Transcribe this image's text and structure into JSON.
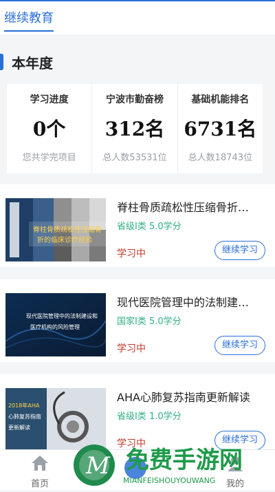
{
  "header": {
    "tab_label": "继续教育"
  },
  "section": {
    "title": "本年度"
  },
  "stats": [
    {
      "label": "学习进度",
      "value": "0个",
      "sub": "您共学完项目"
    },
    {
      "label": "宁波市勤奋榜",
      "value": "312名",
      "sub": "总人数53531位"
    },
    {
      "label": "基础机能排名",
      "value": "6731名",
      "sub": "总人数18743位"
    }
  ],
  "courses": [
    {
      "title": "脊柱骨质疏松性压缩骨折…",
      "level": "省级I类  5.0学分",
      "status": "学习中",
      "button": "继续学习",
      "thumb_text_1": "脊柱骨质疏松性压缩骨",
      "thumb_text_2": "折的临床诊疗经验"
    },
    {
      "title": "现代医院管理中的法制建…",
      "level": "国家I类  5.0学分",
      "status": "学习中",
      "button": "继续学习",
      "thumb_text_1": "现代医院管理中的法制建设和",
      "thumb_text_2": "医疗机构的风险管理"
    },
    {
      "title": "AHA心肺复苏指南更新解读",
      "level": "省级I类  1.0学分",
      "status": "学习中",
      "button": "继续学习",
      "thumb_text_1": "2018年AHA",
      "thumb_text_2": "心肺复苏指南",
      "thumb_text_3": "更新解读"
    }
  ],
  "tabbar": {
    "home_label": "首页",
    "me_label": "我的"
  },
  "watermark": {
    "text": "免费手游网",
    "sub": "MIANFEISHOUYOUWANG"
  },
  "colors": {
    "accent": "#2a6fd6",
    "green": "#2fae82",
    "status_red": "#c0392b"
  }
}
